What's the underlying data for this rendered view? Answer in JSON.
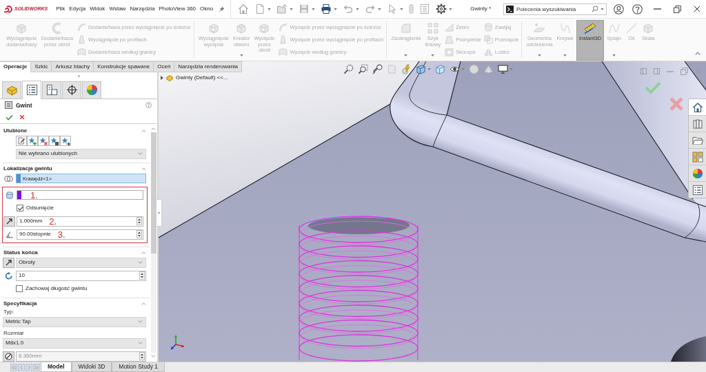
{
  "title_bar": {
    "logo": "SOLIDWORKS",
    "menu": [
      "Plik",
      "Edycja",
      "Widok",
      "Wstaw",
      "Narzędzia",
      "PhotoView 360",
      "Okno"
    ],
    "document_title": "Gwinty *",
    "search": {
      "placeholder": "Polecenia wyszukiwania"
    }
  },
  "ribbon": {
    "groups": [
      {
        "columns": [
          {
            "kind": "large",
            "label": "Wyciągnięcie dodania/bazy",
            "disabled": true,
            "on": false,
            "dropdown": false
          },
          {
            "kind": "large",
            "label": "Dodanie/baza przez obrót",
            "disabled": true,
            "on": false,
            "dropdown": false
          },
          {
            "kind": "stack",
            "items": [
              {
                "label": "Dodanie/baza przez wyciągnięcie po ścieżce",
                "disabled": true
              },
              {
                "label": "Wyciągnięcie po profilach",
                "disabled": true
              },
              {
                "label": "Dodanie/baza według granicy",
                "disabled": true
              }
            ]
          }
        ]
      },
      {
        "columns": [
          {
            "kind": "large",
            "label": "Wyciągnięcie wycięcia",
            "disabled": true,
            "on": false,
            "dropdown": false
          },
          {
            "kind": "large",
            "label": "Kreator otworu",
            "disabled": true,
            "on": false,
            "dropdown": true
          },
          {
            "kind": "large",
            "label": "Wycięcie przez obrót",
            "disabled": true,
            "on": false,
            "dropdown": false
          },
          {
            "kind": "stack",
            "items": [
              {
                "label": "Wycięcie przez wyciągnięcie po ścieżce",
                "disabled": true
              },
              {
                "label": "Wycięcie przez wyciągnięcie po profilach",
                "disabled": true
              },
              {
                "label": "Wycięcie według granicy",
                "disabled": true
              }
            ]
          }
        ]
      },
      {
        "columns": [
          {
            "kind": "large",
            "label": "Zaokrąglenie",
            "disabled": true,
            "on": false,
            "dropdown": true
          },
          {
            "kind": "large",
            "label": "Szyk liniowy",
            "disabled": true,
            "on": false,
            "dropdown": true
          },
          {
            "kind": "stack",
            "items": [
              {
                "label": "Żebro",
                "disabled": true
              },
              {
                "label": "Pochylenie",
                "disabled": true
              },
              {
                "label": "Skorupa",
                "disabled": true
              }
            ]
          },
          {
            "kind": "stack",
            "items": [
              {
                "label": "Zawijaj",
                "disabled": true
              },
              {
                "label": "Przecięcie",
                "disabled": true
              },
              {
                "label": "Lustro",
                "disabled": true
              }
            ]
          }
        ]
      },
      {
        "columns": [
          {
            "kind": "large",
            "label": "Geometria odniesienia",
            "disabled": true,
            "on": false,
            "dropdown": true
          },
          {
            "kind": "large",
            "label": "Krzywe",
            "disabled": true,
            "on": false,
            "dropdown": true
          },
          {
            "kind": "large",
            "label": "Instant3D",
            "disabled": false,
            "on": true,
            "dropdown": false
          },
          {
            "kind": "large",
            "label": "Splajn",
            "disabled": true,
            "on": false,
            "dropdown": true
          },
          {
            "kind": "large",
            "label": "Oś",
            "disabled": true,
            "on": false,
            "dropdown": false
          },
          {
            "kind": "large",
            "label": "Skala",
            "disabled": true,
            "on": false,
            "dropdown": false
          }
        ]
      }
    ]
  },
  "command_tabs": [
    {
      "label": "Operacje",
      "selected": true
    },
    {
      "label": "Szkic",
      "selected": false
    },
    {
      "label": "Arkusz blachy",
      "selected": false
    },
    {
      "label": "Konstrukcje spawane",
      "selected": false
    },
    {
      "label": "Oceń",
      "selected": false
    },
    {
      "label": "Narzędzia renderowania",
      "selected": false
    }
  ],
  "property_manager": {
    "tabs": [
      {
        "selected": false
      },
      {
        "selected": true
      },
      {
        "selected": false
      },
      {
        "selected": false
      },
      {
        "selected": false
      }
    ],
    "title": "Gwint",
    "sections": [
      {
        "title": "Ulubione",
        "expanded": true,
        "rows": [
          {
            "kind": "favorites",
            "in_frame": false
          },
          {
            "kind": "dropdown",
            "value": "Nie wybrano ulubionych",
            "in_frame": false
          }
        ]
      },
      {
        "title": "Lokalizacja gwintu",
        "expanded": true,
        "rows": [
          {
            "kind": "selection",
            "value": "Krawędź<1>",
            "color": "#4f8fd9",
            "focused": true,
            "in_frame": false
          },
          {
            "kind": "selection",
            "color": "#7a14e0",
            "focused": false,
            "annotation": "1.",
            "in_frame": true
          },
          {
            "kind": "checkbox",
            "label": "Odsunięcie",
            "checked": true,
            "in_frame": true
          },
          {
            "kind": "spin",
            "value": "1.000mm",
            "disabled": false,
            "annotation": "2.",
            "in_frame": true
          },
          {
            "kind": "spin",
            "value": "90.00stopnie",
            "disabled": false,
            "annotation": "3.",
            "in_frame": true
          }
        ]
      },
      {
        "title": "Status końca",
        "expanded": true,
        "rows": [
          {
            "kind": "dropdown",
            "value": "Obroty",
            "in_frame": false
          },
          {
            "kind": "spin",
            "value": "10",
            "disabled": false,
            "in_frame": false
          },
          {
            "kind": "checkbox",
            "label": "Zachowaj długość gwintu",
            "checked": false,
            "in_frame": false
          }
        ]
      },
      {
        "title": "Specyfikacja",
        "expanded": true,
        "rows": [
          {
            "kind": "label",
            "text": "Typ:",
            "in_frame": false
          },
          {
            "kind": "dropdown",
            "value": "Metric Tap",
            "in_frame": false
          },
          {
            "kind": "label",
            "text": "Rozmiar",
            "in_frame": false
          },
          {
            "kind": "dropdown",
            "value": "M8x1.0",
            "in_frame": false
          },
          {
            "kind": "spin",
            "value": "6.350mm",
            "disabled": true,
            "in_frame": false
          }
        ]
      }
    ]
  },
  "viewport": {
    "tree_item": "Gwinty (Default) <<...",
    "task_pane_tabs": [
      {
        "selected": true
      },
      {
        "selected": false
      },
      {
        "selected": false
      },
      {
        "selected": false
      },
      {
        "selected": false
      },
      {
        "selected": false
      }
    ]
  },
  "bottom_tabs": [
    {
      "label": "Model",
      "selected": true
    },
    {
      "label": "Widoki 3D",
      "selected": false
    },
    {
      "label": "Motion Study 1",
      "selected": false
    }
  ]
}
